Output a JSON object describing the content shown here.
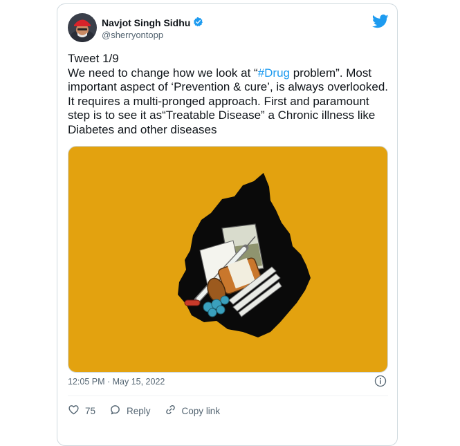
{
  "author": {
    "display_name": "Navjot Singh Sidhu",
    "handle": "@sherryontopp",
    "verified": true
  },
  "tweet": {
    "counter": "Tweet 1/9",
    "text_before_hashtag": "We need to change how we look at “",
    "hashtag": "#Drug",
    "text_after_hashtag": " problem”. Most important aspect of ‘Prevention & cure’, is always overlooked. It requires a multi-pronged approach. First and paramount step is to see it as“Treatable Disease” a Chronic illness like Diabetes and other diseases",
    "timestamp": "12:05 PM · May 15, 2022"
  },
  "actions": {
    "like_count": "75",
    "reply_label": "Reply",
    "copy_link_label": "Copy link"
  },
  "colors": {
    "accent": "#1d9bf0",
    "media_background": "#e3a20f",
    "like_icon": "#536471"
  },
  "icons": {
    "brand": "twitter-bird-icon",
    "verified": "verified-badge-icon",
    "info": "info-icon",
    "like": "heart-icon",
    "reply": "speech-bubble-icon",
    "copy_link": "link-icon"
  }
}
